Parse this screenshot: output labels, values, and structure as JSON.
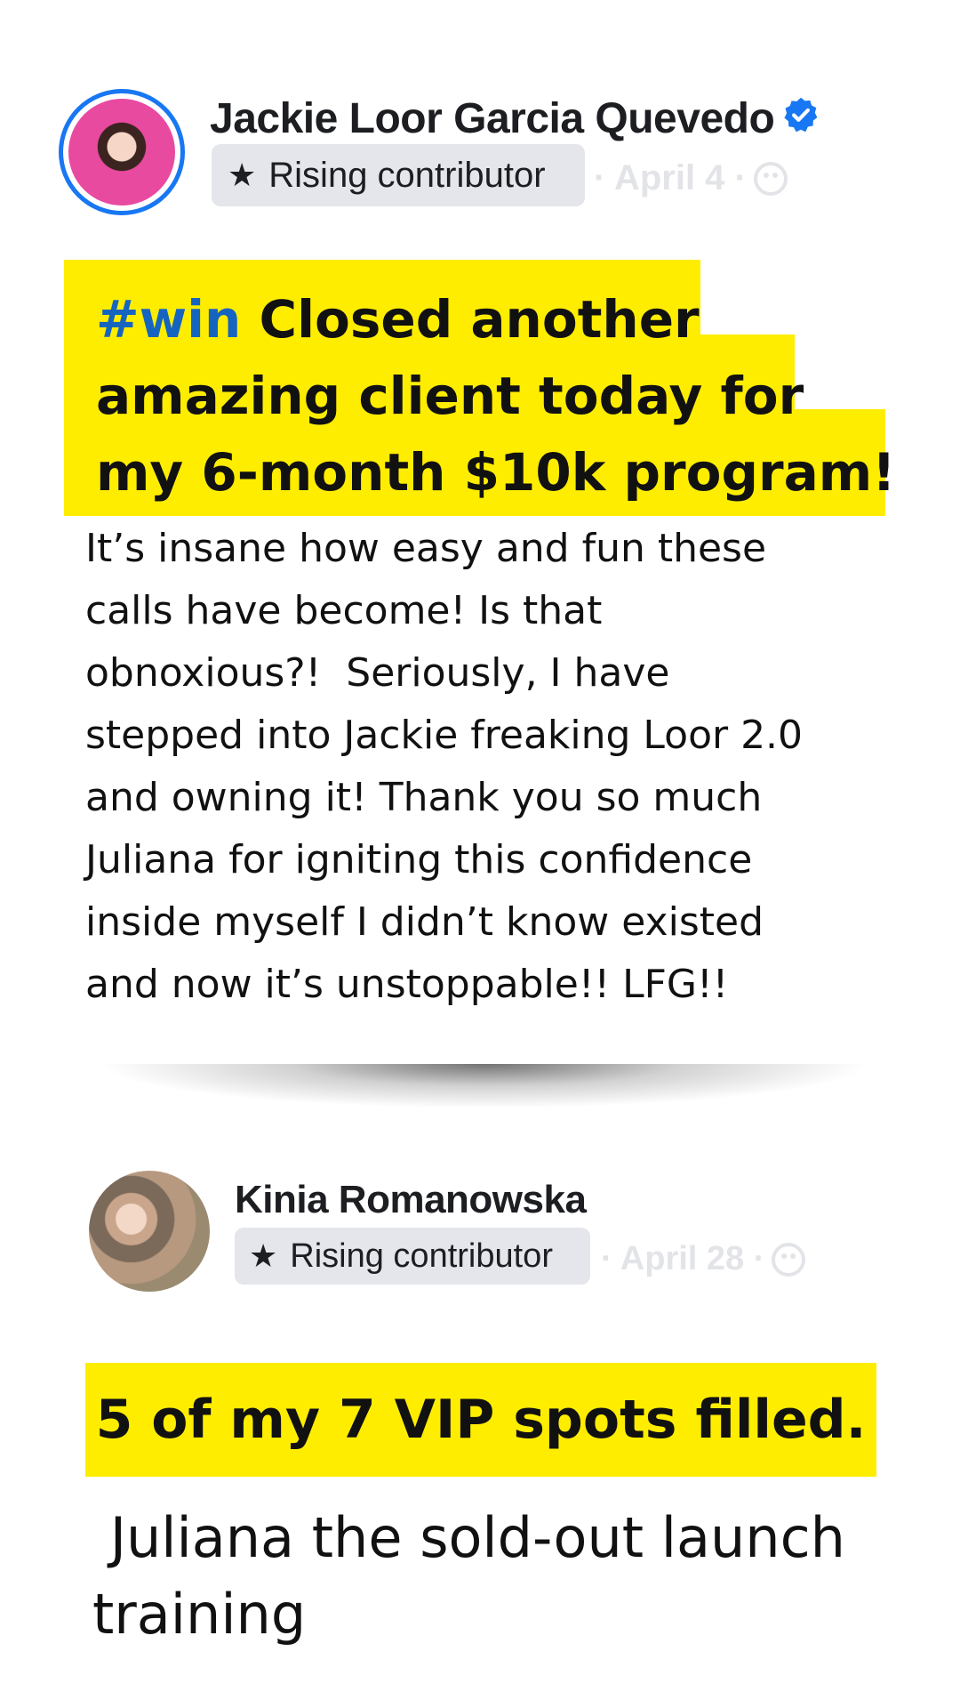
{
  "posts": [
    {
      "author": "Jackie Loor Garcia Quevedo",
      "verified": true,
      "badge": "Rising contributor",
      "date": "· April 4 ·",
      "headline_hashtag": "#win",
      "headline_line1_rest": " Closed another",
      "headline_line2": "amazing client today for",
      "headline_line3": "my 6-month $10k program!",
      "body": "It’s insane how easy and fun these\ncalls have become! Is that\nobnoxious?!  Seriously, I have\nstepped into Jackie freaking Loor 2.0\nand owning it! Thank you so much\nJuliana for igniting this confidence\ninside myself I didn’t know existed\nand now it’s unstoppable!! LFG!!"
    },
    {
      "author": "Kinia Romanowska",
      "verified": false,
      "badge": "Rising contributor",
      "date": "· April 28 ·",
      "headline": "5 of my 7 VIP spots filled.",
      "body": " Juliana the sold-out launch\ntraining"
    }
  ],
  "colors": {
    "highlight": "#ffed00",
    "hashtag": "#1565c0",
    "verified": "#1877f2",
    "badge_bg": "#e4e6eb",
    "meta": "#e2e4e8"
  },
  "icons": [
    "verified-icon",
    "star-icon",
    "globe-icon"
  ]
}
